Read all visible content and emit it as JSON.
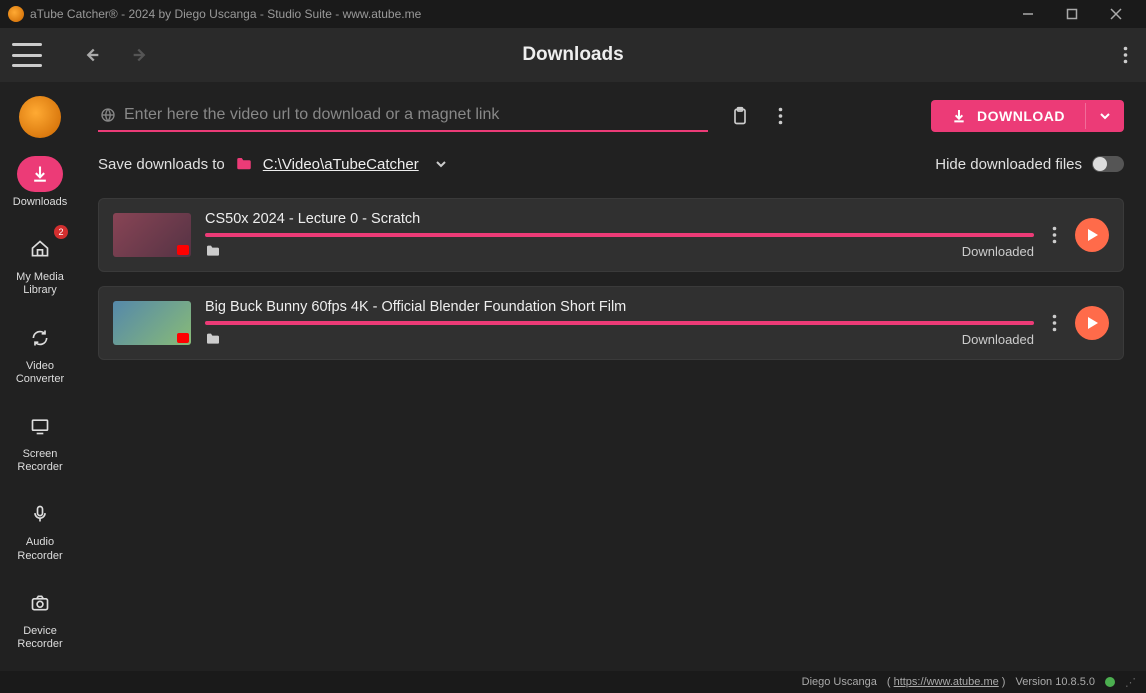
{
  "window": {
    "title": "aTube Catcher® - 2024 by Diego Uscanga - Studio Suite - www.atube.me"
  },
  "topbar": {
    "title": "Downloads"
  },
  "sidebar": {
    "items": [
      {
        "label": "Downloads",
        "icon": "download-icon",
        "active": true
      },
      {
        "label": "My Media Library",
        "icon": "home-icon",
        "badge": "2"
      },
      {
        "label": "Video Converter",
        "icon": "refresh-icon"
      },
      {
        "label": "Screen Recorder",
        "icon": "monitor-icon"
      },
      {
        "label": "Audio Recorder",
        "icon": "mic-icon"
      },
      {
        "label": "Device Recorder",
        "icon": "camera-icon"
      }
    ]
  },
  "main": {
    "url_placeholder": "Enter here the video url to download or a magnet link",
    "download_button": "DOWNLOAD",
    "save_label": "Save downloads to",
    "save_path": "C:\\Video\\aTubeCatcher",
    "hide_label": "Hide downloaded files"
  },
  "downloads": [
    {
      "title": "CS50x 2024 - Lecture 0 - Scratch",
      "status": "Downloaded",
      "progress": 100
    },
    {
      "title": "Big Buck Bunny 60fps 4K - Official Blender Foundation Short Film",
      "status": "Downloaded",
      "progress": 100
    }
  ],
  "statusbar": {
    "author": "Diego Uscanga",
    "url": "https://www.atube.me",
    "version_label": "Version 10.8.5.0"
  }
}
